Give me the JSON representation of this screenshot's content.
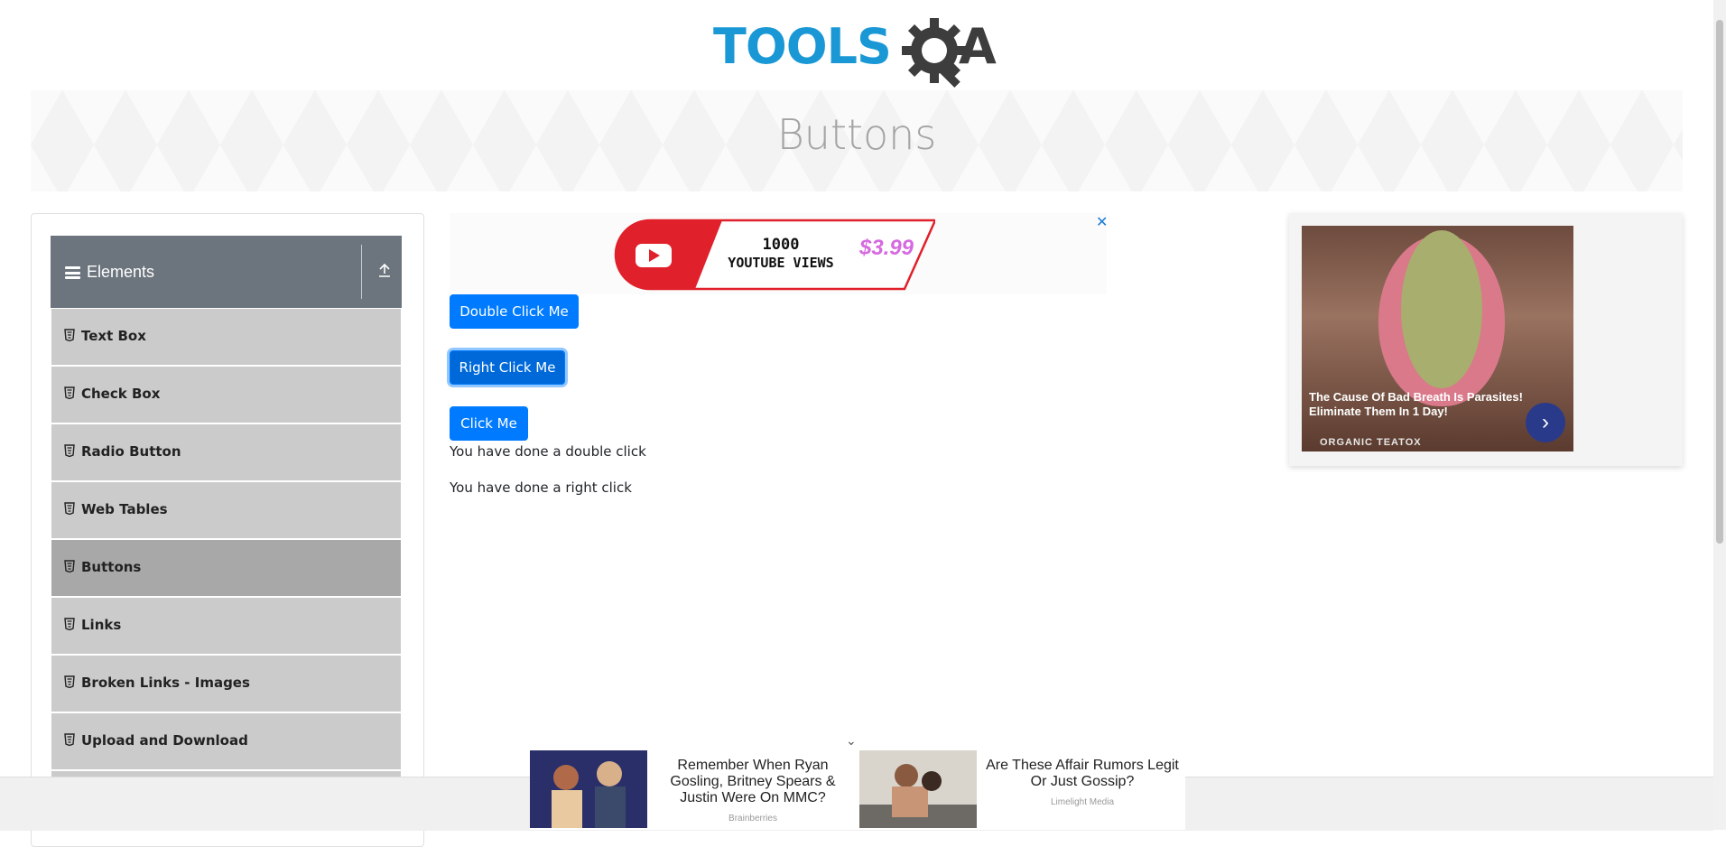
{
  "header": {
    "logo_text_1": "TOOLS",
    "logo_text_2": "A"
  },
  "page": {
    "title": "Buttons"
  },
  "sidebar": {
    "group_label": "Elements",
    "items": [
      {
        "label": "Text Box"
      },
      {
        "label": "Check Box"
      },
      {
        "label": "Radio Button"
      },
      {
        "label": "Web Tables"
      },
      {
        "label": "Buttons",
        "active": true
      },
      {
        "label": "Links"
      },
      {
        "label": "Broken Links - Images"
      },
      {
        "label": "Upload and Download"
      }
    ]
  },
  "mid_ad": {
    "close": "✕",
    "line1": "1000",
    "line2": "YOUTUBE VIEWS",
    "price": "$3.99"
  },
  "buttons": {
    "double_click": "Double Click Me",
    "right_click": "Right Click Me",
    "click": "Click Me"
  },
  "messages": {
    "double": "You have done a double click",
    "right": "You have done a right click"
  },
  "right_ad": {
    "caption": "The Cause Of Bad Breath Is Parasites! Eliminate Them In 1 Day!",
    "sponsor": "ORGANIC TEATOX",
    "arrow": "›"
  },
  "bottom_ad": {
    "chevron": "⌄",
    "cards": [
      {
        "headline": "Remember When Ryan Gosling, Britney Spears & Justin Were On MMC?",
        "source": "Brainberries"
      },
      {
        "headline": "Are These Affair Rumors Legit Or Just Gossip?",
        "source": "Limelight Media"
      }
    ]
  },
  "colors": {
    "primary": "#007bff",
    "sidebar_header": "#6c757d",
    "menu_item": "#cbcbcb",
    "menu_active": "#a8a8a8",
    "logo_blue": "#1a98d5"
  }
}
